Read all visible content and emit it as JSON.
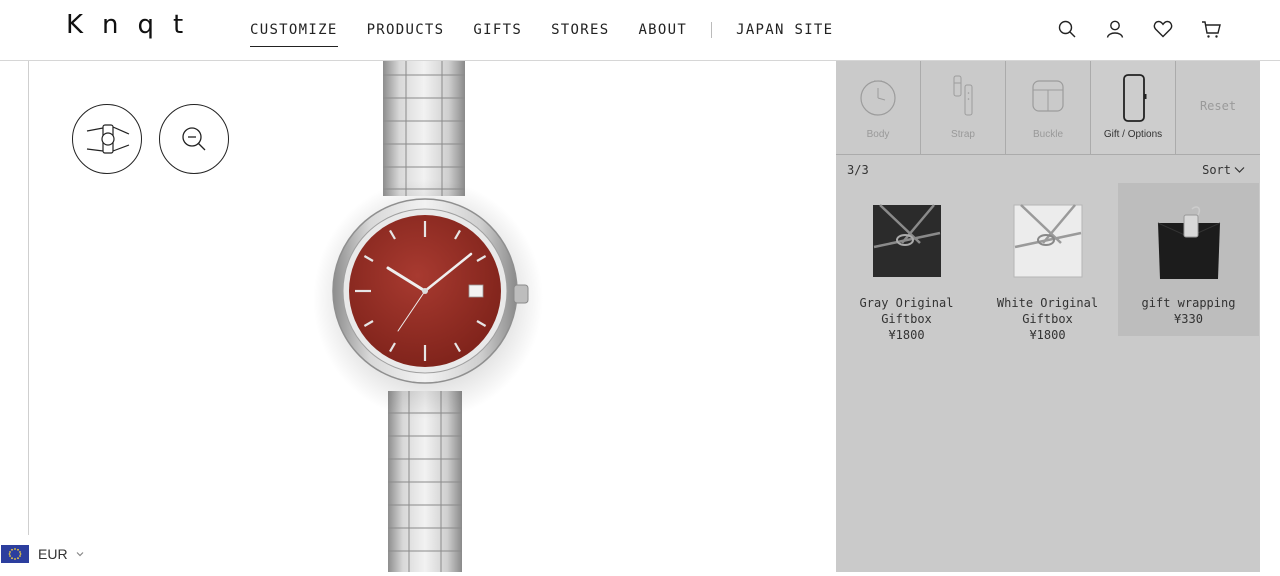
{
  "brand": {
    "logo_text": "Knqt"
  },
  "nav": {
    "items": [
      {
        "label": "CUSTOMIZE",
        "active": true
      },
      {
        "label": "PRODUCTS",
        "active": false
      },
      {
        "label": "GIFTS",
        "active": false
      },
      {
        "label": "STORES",
        "active": false
      },
      {
        "label": "ABOUT",
        "active": false
      }
    ],
    "japan_site": "JAPAN SITE"
  },
  "header_icons": [
    "search-icon",
    "account-icon",
    "heart-icon",
    "cart-icon"
  ],
  "stage": {
    "tools": [
      "wrist-view-icon",
      "zoom-out-icon"
    ]
  },
  "currency": {
    "code": "EUR",
    "flag": "eu-flag-icon"
  },
  "panel": {
    "tabs": [
      {
        "label": "Body",
        "icon": "watch-body-icon"
      },
      {
        "label": "Strap",
        "icon": "strap-icon"
      },
      {
        "label": "Buckle",
        "icon": "buckle-icon"
      },
      {
        "label": "Gift / Options",
        "icon": "gift-options-icon",
        "active": true
      }
    ],
    "reset_label": "Reset",
    "count": "3/3",
    "sort_label": "Sort",
    "products": [
      {
        "name": "Gray Original Giftbox",
        "line1": "Gray Original",
        "line2": "Giftbox",
        "price": "¥1800",
        "selected": false
      },
      {
        "name": "White Original Giftbox",
        "line1": "White Original",
        "line2": "Giftbox",
        "price": "¥1800",
        "selected": false
      },
      {
        "name": "gift wrapping",
        "line1": "gift wrapping",
        "line2": "",
        "price": "¥330",
        "selected": true
      }
    ]
  },
  "colors": {
    "dial": "#8e2a22",
    "panel_bg": "#cacaca",
    "selected_bg": "#bdbdbd"
  }
}
